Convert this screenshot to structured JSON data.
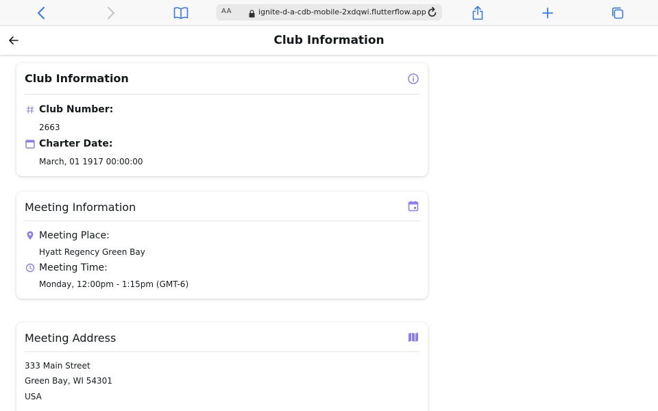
{
  "browser": {
    "reader_label": "AA",
    "url": "ignite-d-a-cdb-mobile-2xdqwi.flutterflow.app"
  },
  "header": {
    "title": "Club Information"
  },
  "club_card": {
    "title": "Club Information",
    "club_number_label": "Club Number:",
    "club_number": "2663",
    "charter_date_label": "Charter Date:",
    "charter_date": "March, 01 1917 00:00:00"
  },
  "meeting_card": {
    "title": "Meeting Information",
    "place_label": "Meeting Place:",
    "place": "Hyatt Regency Green Bay",
    "time_label": "Meeting Time:",
    "time": "Monday, 12:00pm - 1:15pm  (GMT-6)"
  },
  "address_card": {
    "title": "Meeting Address",
    "lines": [
      "333 Main Street",
      "Green Bay, WI  54301",
      "USA"
    ]
  },
  "colors": {
    "accent": "#8b7ff0",
    "text": "#14181b"
  }
}
